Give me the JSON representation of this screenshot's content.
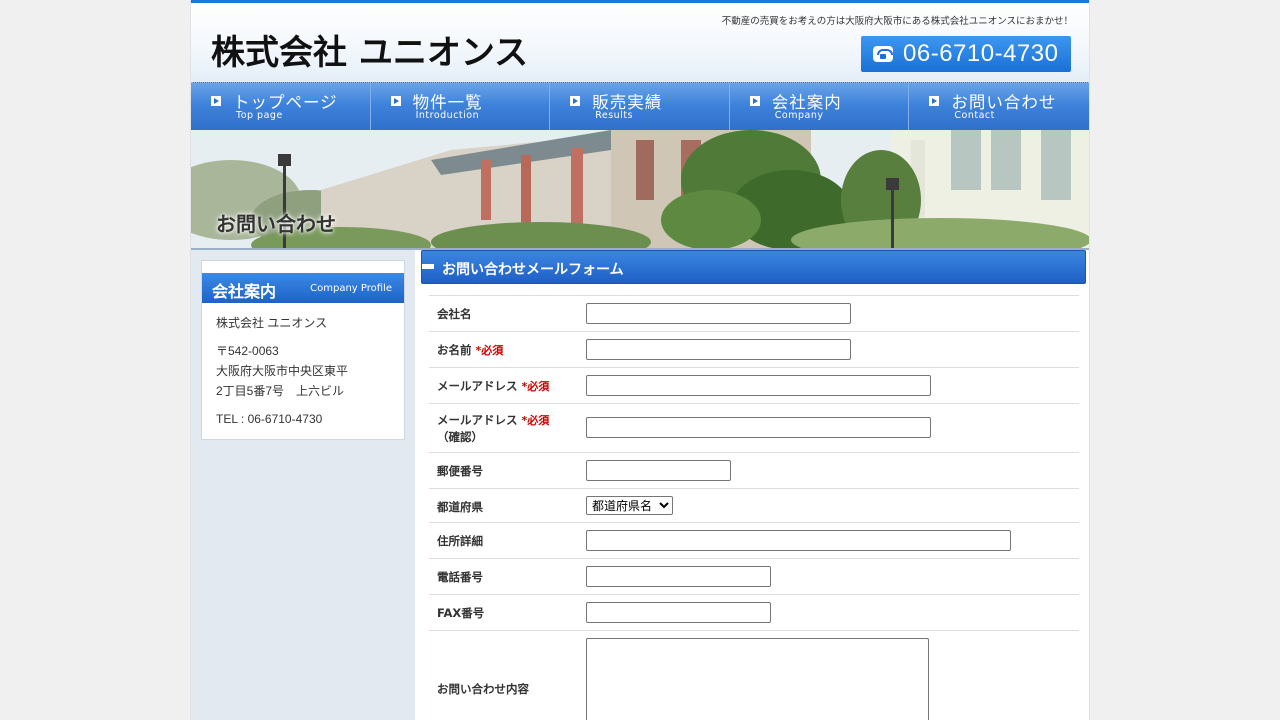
{
  "header": {
    "logo": "株式会社 ユニオンス",
    "tagline": "不動産の売買をお考えの方は大阪府大阪市にある株式会社ユニオンスにおまかせ！",
    "phone": "06-6710-4730"
  },
  "nav": [
    {
      "jp": "トップページ",
      "en": "Top page"
    },
    {
      "jp": "物件一覧",
      "en": "Introduction"
    },
    {
      "jp": "販売実績",
      "en": "Results"
    },
    {
      "jp": "会社案内",
      "en": "Company"
    },
    {
      "jp": "お問い合わせ",
      "en": "Contact"
    }
  ],
  "hero": {
    "title": "お問い合わせ"
  },
  "sidebar": {
    "heading_jp": "会社案内",
    "heading_en": "Company Profile",
    "company": "株式会社 ユニオンス",
    "postal": "〒542-0063",
    "address1": "大阪府大阪市中央区東平",
    "address2": "2丁目5番7号　上六ビル",
    "tel": "TEL : 06-6710-4730"
  },
  "form": {
    "title": "お問い合わせメールフォーム",
    "required_mark": "*必須",
    "fields": {
      "company": {
        "label": "会社名",
        "value": ""
      },
      "name": {
        "label": "お名前",
        "value": ""
      },
      "email": {
        "label": "メールアドレス",
        "value": ""
      },
      "email_confirm": {
        "label": "メールアドレス",
        "label2": "（確認）",
        "value": ""
      },
      "postal": {
        "label": "郵便番号",
        "value": ""
      },
      "prefecture": {
        "label": "都道府県",
        "selected": "都道府県名"
      },
      "address": {
        "label": "住所詳細",
        "value": ""
      },
      "phone": {
        "label": "電話番号",
        "value": ""
      },
      "fax": {
        "label": "FAX番号",
        "value": ""
      },
      "inquiry": {
        "label": "お問い合わせ内容",
        "value": ""
      }
    }
  },
  "colors": {
    "accent": "#1e78d2",
    "nav": "#3e82db",
    "required": "#d00000",
    "sidebar_bg": "#e2e9f1"
  }
}
